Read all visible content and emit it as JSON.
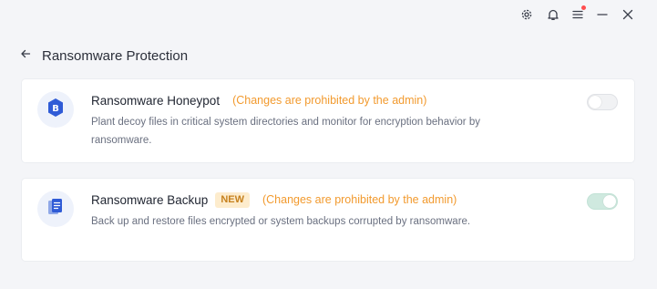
{
  "window_controls": {
    "settings_icon": "gear-icon",
    "notifications_icon": "bell-icon",
    "menu_icon": "hamburger-menu-icon",
    "minimize_icon": "minimize-icon",
    "close_icon": "close-icon",
    "menu_has_notification": true
  },
  "header": {
    "back_icon": "arrow-left-icon",
    "title": "Ransomware Protection"
  },
  "cards": [
    {
      "icon": "bitcoin-shield-icon",
      "title": "Ransomware Honeypot",
      "badge": "",
      "note": "(Changes are prohibited by the admin)",
      "description": "Plant decoy files in critical system directories and monitor for encryption behavior by ransomware.",
      "toggle_on": false
    },
    {
      "icon": "document-copy-icon",
      "title": "Ransomware Backup",
      "badge": "NEW",
      "note": "(Changes are prohibited by the admin)",
      "description": "Back up and restore files encrypted or system backups corrupted by ransomware.",
      "toggle_on": true
    }
  ],
  "colors": {
    "accent": "#2f5bd6",
    "note": "#f29a2e",
    "badge_bg": "#fdeccd",
    "badge_text": "#c6811e",
    "toggle_on": "#cfe9df",
    "toggle_off": "#f1f2f4"
  }
}
